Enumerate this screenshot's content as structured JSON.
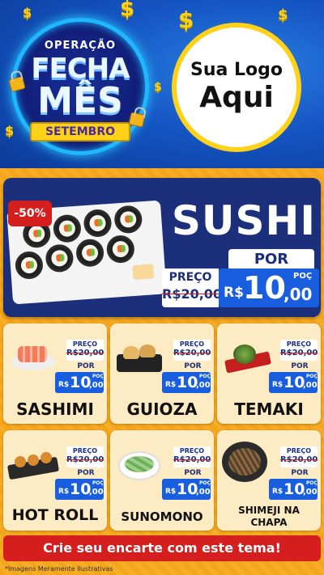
{
  "banner": {
    "badge": {
      "line1": "OPERAÇÃO",
      "line2": "FECHA",
      "line3": "MÊS",
      "ribbon": "SETEMBRO"
    },
    "logo": {
      "line1": "Sua Logo",
      "line2": "Aqui"
    },
    "dollar_glyph": "$"
  },
  "hero": {
    "discount": "-50%",
    "title": "SUSHI",
    "por_label": "POR",
    "preco_label": "PREÇO",
    "old_price": "R$20,00",
    "currency": "R$",
    "price_int": "10",
    "price_dec": ",00",
    "unit": "POÇ"
  },
  "products": [
    {
      "name": "SASHIMI",
      "preco_label": "PREÇO",
      "old_price": "R$20,00",
      "por_label": "POR",
      "currency": "R$",
      "price_int": "10",
      "price_dec": ",00",
      "unit": "POÇ"
    },
    {
      "name": "GUIOZA",
      "preco_label": "PREÇO",
      "old_price": "R$20,00",
      "por_label": "POR",
      "currency": "R$",
      "price_int": "10",
      "price_dec": ",00",
      "unit": "POÇ"
    },
    {
      "name": "TEMAKI",
      "preco_label": "PREÇO",
      "old_price": "R$20,00",
      "por_label": "POR",
      "currency": "R$",
      "price_int": "10",
      "price_dec": ",00",
      "unit": "POÇ"
    },
    {
      "name": "HOT ROLL",
      "preco_label": "PREÇO",
      "old_price": "R$20,00",
      "por_label": "POR",
      "currency": "R$",
      "price_int": "10",
      "price_dec": ",00",
      "unit": "POÇ"
    },
    {
      "name": "SUNOMONO",
      "preco_label": "PREÇO",
      "old_price": "R$20,00",
      "por_label": "POR",
      "currency": "R$",
      "price_int": "10",
      "price_dec": ",00",
      "unit": "POÇ"
    },
    {
      "name_line1": "SHIMEJI NA",
      "name_line2": "CHAPA",
      "preco_label": "PREÇO",
      "old_price": "R$20,00",
      "por_label": "POR",
      "currency": "R$",
      "price_int": "10",
      "price_dec": ",00",
      "unit": "POÇ"
    }
  ],
  "footer": {
    "cta": "Crie seu encarte com este tema!",
    "disclaimer": "*Imagens Meramente Ilustrativas"
  },
  "colors": {
    "banner_blue": "#1556c4",
    "gold": "#ffd21a",
    "hero_navy": "#1b2f7a",
    "price_blue": "#1a5ee0",
    "red": "#d51f1f",
    "orange_bg": "#f5a51c",
    "card_bg": "#fdebc4"
  }
}
